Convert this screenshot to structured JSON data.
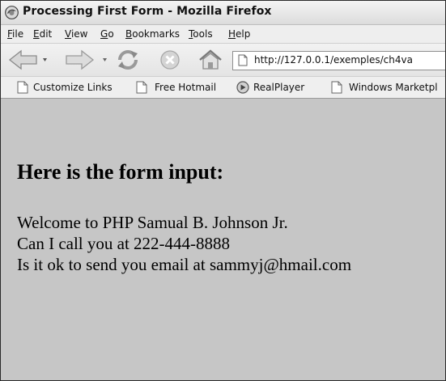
{
  "window": {
    "title": "Processing First Form - Mozilla Firefox"
  },
  "menu": {
    "items": [
      {
        "accel": "F",
        "rest": "ile"
      },
      {
        "accel": "E",
        "rest": "dit"
      },
      {
        "accel": "V",
        "rest": "iew"
      },
      {
        "accel": "G",
        "rest": "o"
      },
      {
        "accel": "B",
        "rest": "ookmarks"
      },
      {
        "accel": "T",
        "rest": "ools"
      },
      {
        "accel": "H",
        "rest": "elp"
      }
    ]
  },
  "toolbar": {
    "icons": [
      "back-arrow-icon",
      "forward-arrow-icon",
      "reload-icon",
      "stop-icon",
      "home-icon"
    ],
    "url": "http://127.0.0.1/exemples/ch4va"
  },
  "bookmarks": {
    "items": [
      {
        "label": "Customize Links",
        "icon": "page-icon"
      },
      {
        "label": "Free Hotmail",
        "icon": "page-icon"
      },
      {
        "label": "RealPlayer",
        "icon": "realplayer-icon"
      },
      {
        "label": "Windows Marketpl",
        "icon": "page-icon"
      }
    ]
  },
  "page": {
    "heading": "Here is the form input:",
    "lines": [
      "Welcome to PHP Samual B. Johnson Jr.",
      "Can I call you at 222-444-8888",
      "Is it ok to send you email at sammyj@hmail.com"
    ]
  },
  "colors": {
    "content_bg": "#c6c6c6",
    "chrome_bg": "#eeeeee"
  }
}
